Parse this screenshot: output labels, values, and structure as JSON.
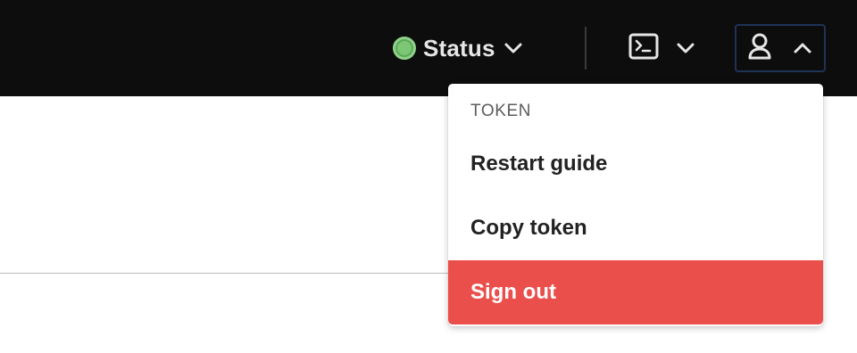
{
  "topbar": {
    "status_label": "Status",
    "status_color": "#7cc676",
    "icons": {
      "status": "status-circle-icon",
      "status_chevron": "chevron-down-icon",
      "terminal": "terminal-icon",
      "terminal_chevron": "chevron-down-icon",
      "user": "user-icon",
      "user_chevron": "chevron-up-icon"
    }
  },
  "dropdown": {
    "header": "TOKEN",
    "items": [
      {
        "label": "Restart guide"
      },
      {
        "label": "Copy token"
      },
      {
        "label": "Sign out",
        "color": "#eb4f4b"
      }
    ]
  }
}
